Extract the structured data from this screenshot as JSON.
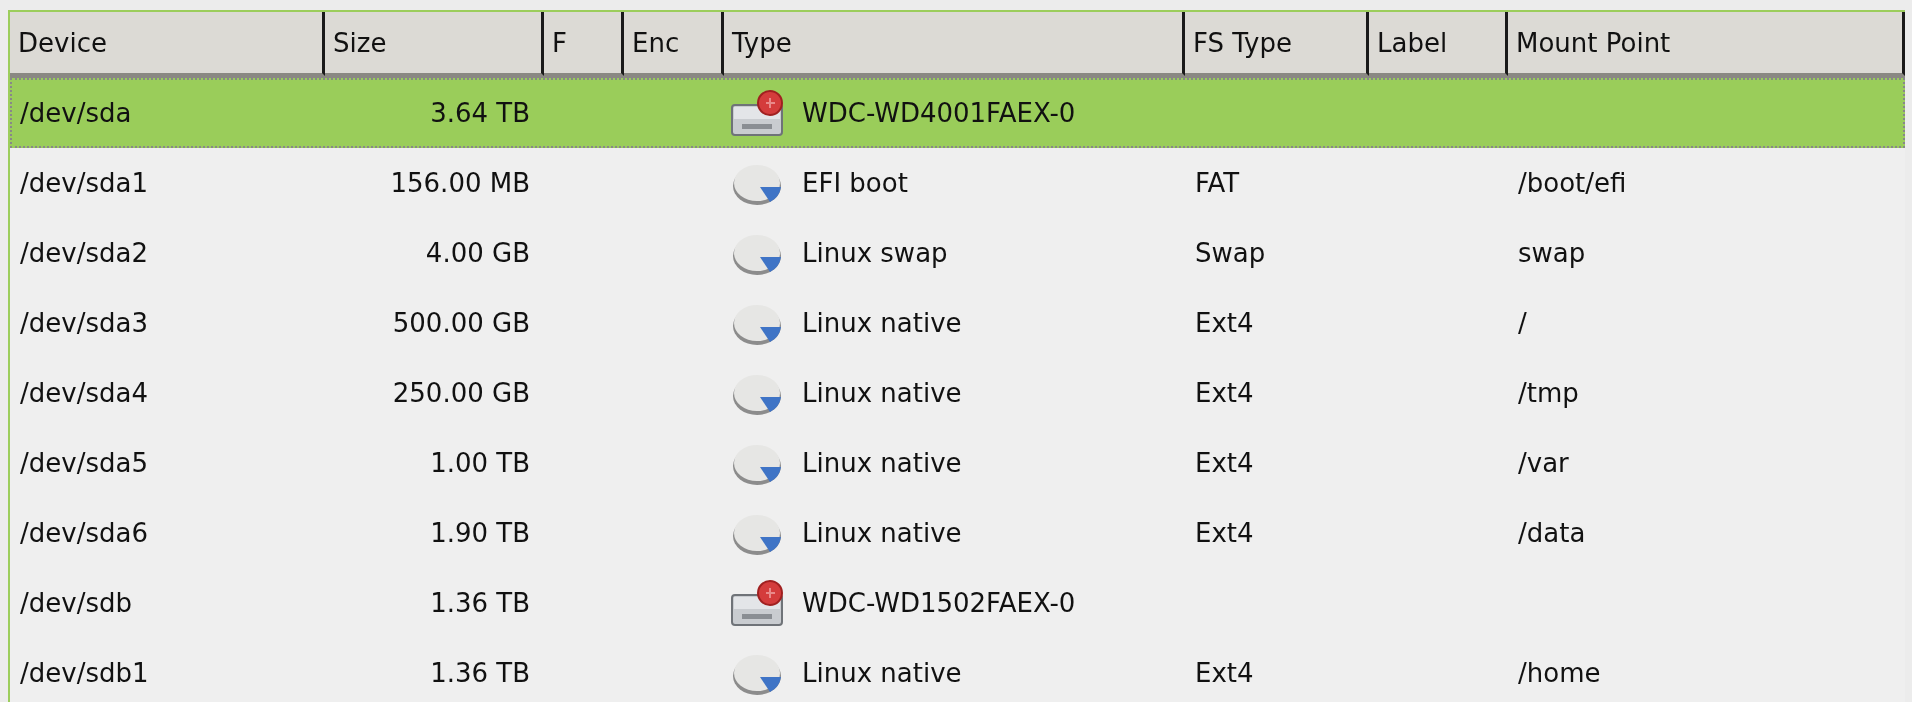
{
  "table": {
    "columns": [
      "Device",
      "Size",
      "F",
      "Enc",
      "Type",
      "FS Type",
      "Label",
      "Mount Point"
    ],
    "rows": [
      {
        "device": "/dev/sda",
        "size": "3.64 TB",
        "kind": "disk",
        "type": "WDC-WD4001FAEX-0",
        "selected": true
      },
      {
        "device": "/dev/sda1",
        "size": "156.00 MB",
        "kind": "partition",
        "type": "EFI boot",
        "fs_type": "FAT",
        "mount_point": "/boot/efi",
        "selected": false
      },
      {
        "device": "/dev/sda2",
        "size": "4.00 GB",
        "kind": "partition",
        "type": "Linux swap",
        "fs_type": "Swap",
        "mount_point": "swap",
        "selected": false
      },
      {
        "device": "/dev/sda3",
        "size": "500.00 GB",
        "kind": "partition",
        "type": "Linux native",
        "fs_type": "Ext4",
        "mount_point": "/",
        "selected": false
      },
      {
        "device": "/dev/sda4",
        "size": "250.00 GB",
        "kind": "partition",
        "type": "Linux native",
        "fs_type": "Ext4",
        "mount_point": "/tmp",
        "selected": false
      },
      {
        "device": "/dev/sda5",
        "size": "1.00 TB",
        "kind": "partition",
        "type": "Linux native",
        "fs_type": "Ext4",
        "mount_point": "/var",
        "selected": false
      },
      {
        "device": "/dev/sda6",
        "size": "1.90 TB",
        "kind": "partition",
        "type": "Linux native",
        "fs_type": "Ext4",
        "mount_point": "/data",
        "selected": false
      },
      {
        "device": "/dev/sdb",
        "size": "1.36 TB",
        "kind": "disk",
        "type": "WDC-WD1502FAEX-0",
        "selected": false
      },
      {
        "device": "/dev/sdb1",
        "size": "1.36 TB",
        "kind": "partition",
        "type": "Linux native",
        "fs_type": "Ext4",
        "mount_point": "/home",
        "selected": false
      }
    ]
  }
}
